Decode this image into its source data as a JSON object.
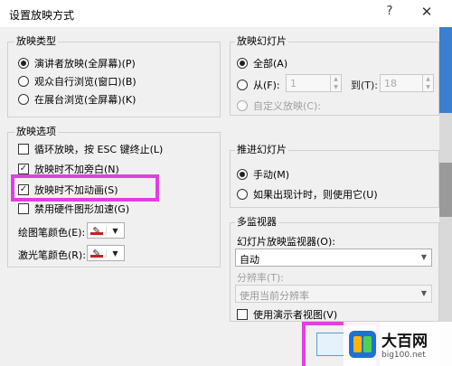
{
  "window": {
    "title": "设置放映方式",
    "help": "?",
    "close": "✕"
  },
  "show_type": {
    "title": "放映类型",
    "options": [
      {
        "label": "演讲者放映(全屏幕)(P)",
        "selected": true
      },
      {
        "label": "观众自行浏览(窗口)(B)",
        "selected": false
      },
      {
        "label": "在展台浏览(全屏幕)(K)",
        "selected": false
      }
    ]
  },
  "show_options": {
    "title": "放映选项",
    "items": [
      {
        "label": "循环放映，按 ESC 键终止(L)",
        "checked": false
      },
      {
        "label": "放映时不加旁白(N)",
        "checked": true
      },
      {
        "label": "放映时不加动画(S)",
        "checked": true
      },
      {
        "label": "禁用硬件图形加速(G)",
        "checked": false
      }
    ],
    "pen_color_label": "绘图笔颜色(E):",
    "laser_color_label": "激光笔颜色(R):",
    "pen_color": "#cc1f1f",
    "laser_color": "#cc1f1f"
  },
  "slides": {
    "title": "放映幻灯片",
    "all_label": "全部(A)",
    "from_label": "从(F):",
    "from_value": "1",
    "to_label": "到(T):",
    "to_value": "18",
    "custom_label": "自定义放映(C):"
  },
  "advance": {
    "title": "推进幻灯片",
    "manual_label": "手动(M)",
    "timing_label": "如果出现计时，则使用它(U)"
  },
  "monitors": {
    "title": "多监视器",
    "monitor_label": "幻灯片放映监视器(O):",
    "monitor_value": "自动",
    "resolution_label": "分辨率(T):",
    "resolution_value": "使用当前分辨率",
    "presenter_view_label": "使用演示者视图(V)"
  },
  "watermark": {
    "title": "大百网",
    "url": "big100.net"
  },
  "colors": {
    "highlight": "#e040e0",
    "titlebar": "#ffffff",
    "body": "#f0f0f0"
  }
}
